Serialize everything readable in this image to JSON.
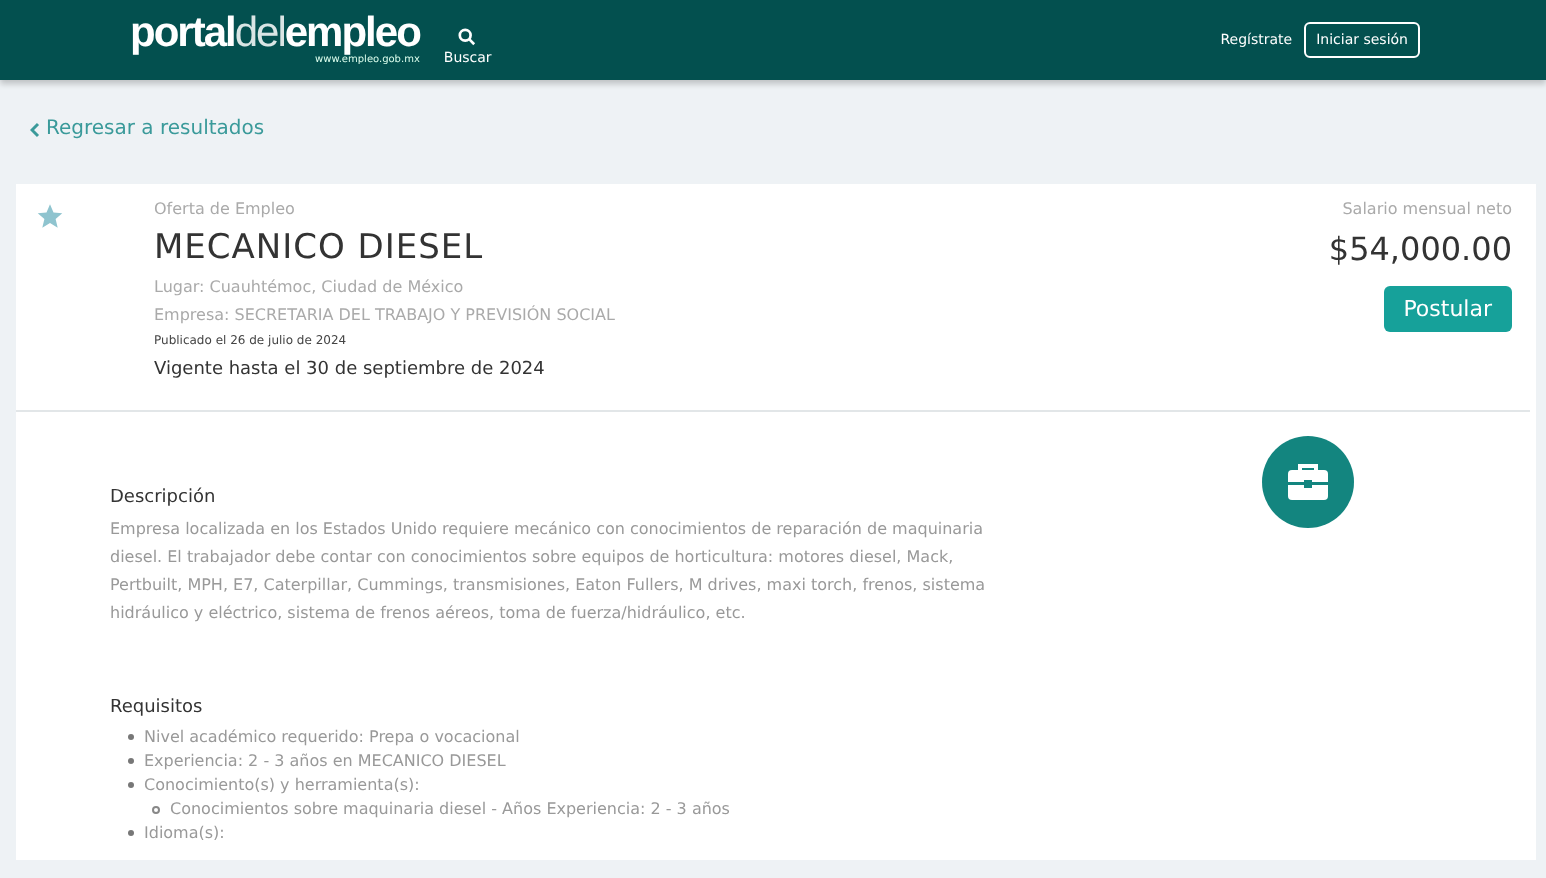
{
  "header": {
    "logo": {
      "parts": [
        {
          "text": "portal",
          "light": false
        },
        {
          "text": "del",
          "light": true
        },
        {
          "text": "empleo",
          "light": false
        }
      ],
      "url": "www.empleo.gob.mx"
    },
    "search_label": "Buscar",
    "register_link": "Regístrate",
    "login_button": "Iniciar sesión"
  },
  "back_link": "Regresar a resultados",
  "offer": {
    "favorite": false,
    "kicker": "Oferta de Empleo",
    "title": "MECANICO DIESEL",
    "place": "Lugar: Cuauhtémoc, Ciudad de México",
    "company": "Empresa: SECRETARIA DEL TRABAJO Y PREVISIÓN SOCIAL",
    "published": "Publicado el 26 de julio de 2024",
    "valid_until": "Vigente hasta el 30 de septiembre de 2024",
    "salary_label": "Salario mensual neto",
    "salary": "$54,000.00",
    "apply_button": "Postular"
  },
  "description": {
    "heading": "Descripción",
    "text": "Empresa localizada en los Estados Unido requiere mecánico con conocimientos de reparación de maquinaria diesel. El trabajador debe contar con conocimientos sobre equipos de horticultura: motores diesel, Mack, Pertbuilt, MPH, E7, Caterpillar, Cummings, transmisiones, Eaton Fullers, M drives, maxi torch, frenos, sistema hidráulico y eléctrico, sistema de frenos aéreos, toma de fuerza/hidráulico, etc."
  },
  "requirements": {
    "heading": "Requisitos",
    "items": [
      {
        "text": "Nivel académico requerido: Prepa o vocacional"
      },
      {
        "text": "Experiencia: 2 - 3 años en MECANICO DIESEL"
      },
      {
        "text": "Conocimiento(s) y herramienta(s):",
        "children": [
          {
            "text": "Conocimientos sobre maquinaria diesel - Años Experiencia: 2 - 3 años"
          }
        ]
      },
      {
        "text": "Idioma(s):"
      }
    ]
  }
}
